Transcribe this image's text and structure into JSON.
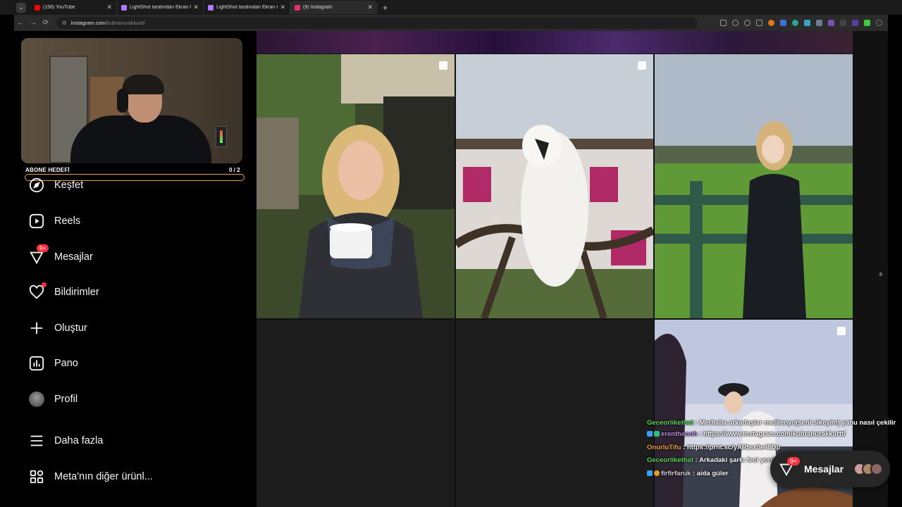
{
  "browser": {
    "tabs": [
      {
        "title": "(156) YouTube",
        "favicon_color": "#ff0000",
        "active": false
      },
      {
        "title": "LightShot tarafından Ekran Görü",
        "favicon_color": "#b07cff",
        "active": false
      },
      {
        "title": "LightShot tarafından Ekran Görü",
        "favicon_color": "#b07cff",
        "active": false
      },
      {
        "title": "(9) Instagram",
        "favicon_color": "#e1306c",
        "active": true
      }
    ],
    "new_tab": "+",
    "url_host": "instagram.com",
    "url_path": "/kubranurakkurtt/"
  },
  "stream_overlay": {
    "goal_label": "ABONE HEDEFİ",
    "goal_count": "0 / 2",
    "goal_progress": 0
  },
  "sidebar": {
    "items": [
      {
        "label": "Keşfet",
        "icon": "compass-icon"
      },
      {
        "label": "Reels",
        "icon": "reels-icon"
      },
      {
        "label": "Mesajlar",
        "icon": "messenger-icon",
        "badge": "9+"
      },
      {
        "label": "Bildirimler",
        "icon": "heart-icon",
        "dot": true
      },
      {
        "label": "Oluştur",
        "icon": "plus-icon"
      },
      {
        "label": "Pano",
        "icon": "dashboard-icon"
      },
      {
        "label": "Profil",
        "icon": "avatar"
      },
      {
        "label": "Daha fazla",
        "icon": "menu-icon"
      },
      {
        "label": "Meta'nın diğer ürünl...",
        "icon": "apps-icon"
      }
    ]
  },
  "chat": [
    {
      "user": "Geceorlikethat",
      "text": ": Merhaba arkadaşlar mıditenyo(seni sikeyim) yahu nasıl çekilir",
      "color": "#5ad657"
    },
    {
      "user": "erentheooh",
      "text": ": https://www.instagram.com/kubranurakkurtt/",
      "color": "#b38bd8"
    },
    {
      "user": "OnurluTifu",
      "text": ": https://prnt.sc/yARtex0e48Dp",
      "color": "#f0a030"
    },
    {
      "user": "Geceorlikethat",
      "text": ": Arkadaki şarkı feci yordu",
      "color": "#5ad657"
    },
    {
      "user": "firfirfaruk",
      "text": ": aida güler",
      "color": "#d8d8d8"
    }
  ],
  "messages_pill": {
    "label": "Mesajlar",
    "badge": "9+"
  },
  "side_marker": "8"
}
